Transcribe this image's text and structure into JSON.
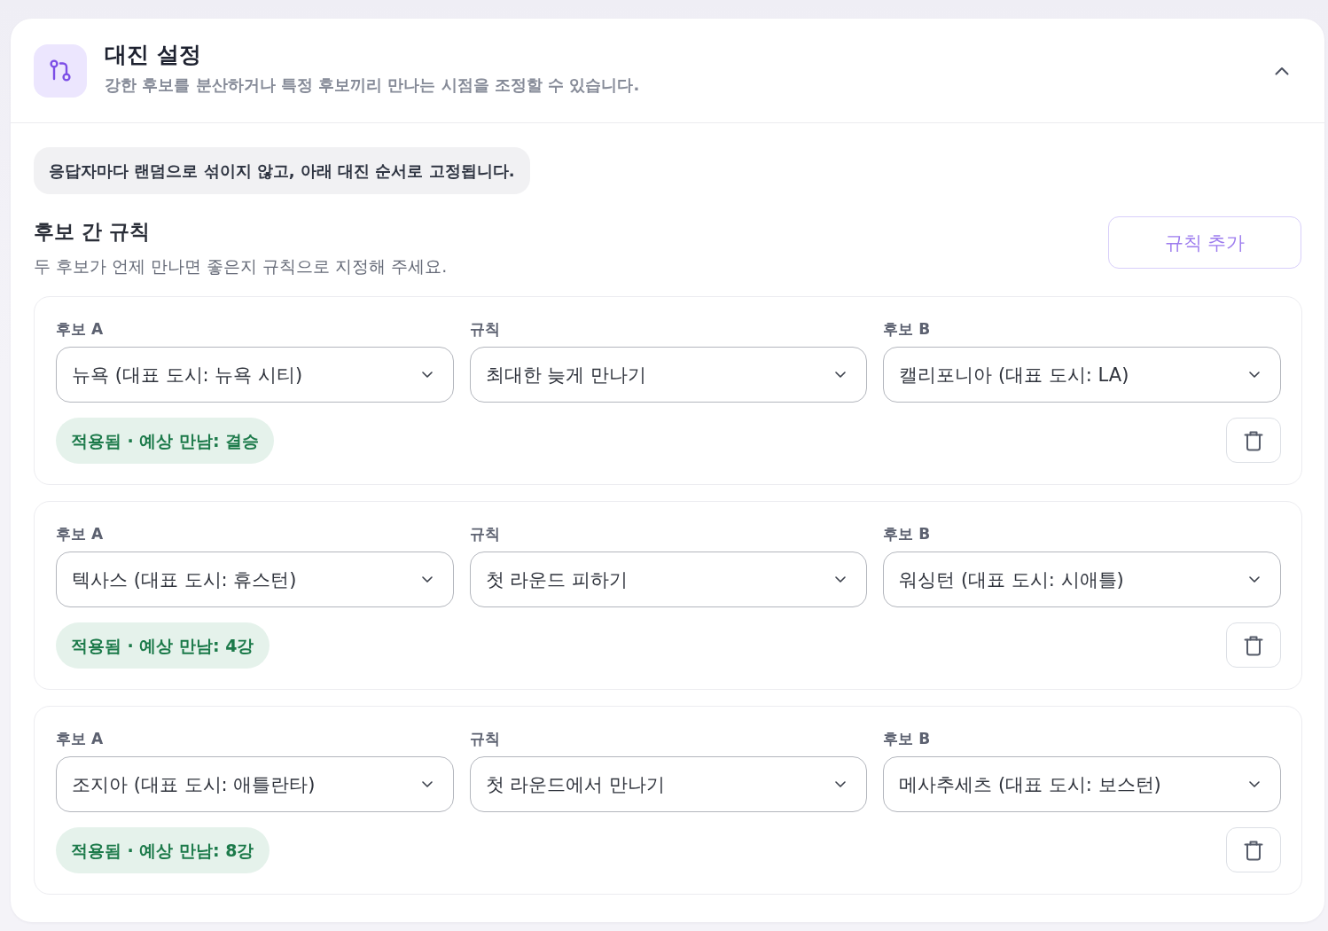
{
  "header": {
    "title": "대진 설정",
    "subtitle": "강한 후보를 분산하거나 특정 후보끼리 만나는 시점을 조정할 수 있습니다.",
    "expanded": true
  },
  "notice": "응답자마다 랜덤으로 섞이지 않고, 아래 대진 순서로 고정됩니다.",
  "rules_section": {
    "title": "후보 간 규칙",
    "description": "두 후보가 언제 만나면 좋은지 규칙으로 지정해 주세요.",
    "add_button": "규칙 추가"
  },
  "rules": [
    {
      "fields": [
        {
          "label": "후보 A",
          "value": "뉴욕 (대표 도시: 뉴욕 시티)"
        },
        {
          "label": "규칙",
          "value": "최대한 늦게 만나기"
        },
        {
          "label": "후보 B",
          "value": "캘리포니아 (대표 도시: LA)"
        }
      ],
      "status": "적용됨 · 예상 만남: 결승"
    },
    {
      "fields": [
        {
          "label": "후보 A",
          "value": "텍사스 (대표 도시: 휴스턴)"
        },
        {
          "label": "규칙",
          "value": "첫 라운드 피하기"
        },
        {
          "label": "후보 B",
          "value": "워싱턴 (대표 도시: 시애틀)"
        }
      ],
      "status": "적용됨 · 예상 만남: 4강"
    },
    {
      "fields": [
        {
          "label": "후보 A",
          "value": "조지아 (대표 도시: 애틀란타)"
        },
        {
          "label": "규칙",
          "value": "첫 라운드에서 만나기"
        },
        {
          "label": "후보 B",
          "value": "메사추세츠 (대표 도시: 보스턴)"
        }
      ],
      "status": "적용됨 · 예상 만남: 8강"
    }
  ]
}
